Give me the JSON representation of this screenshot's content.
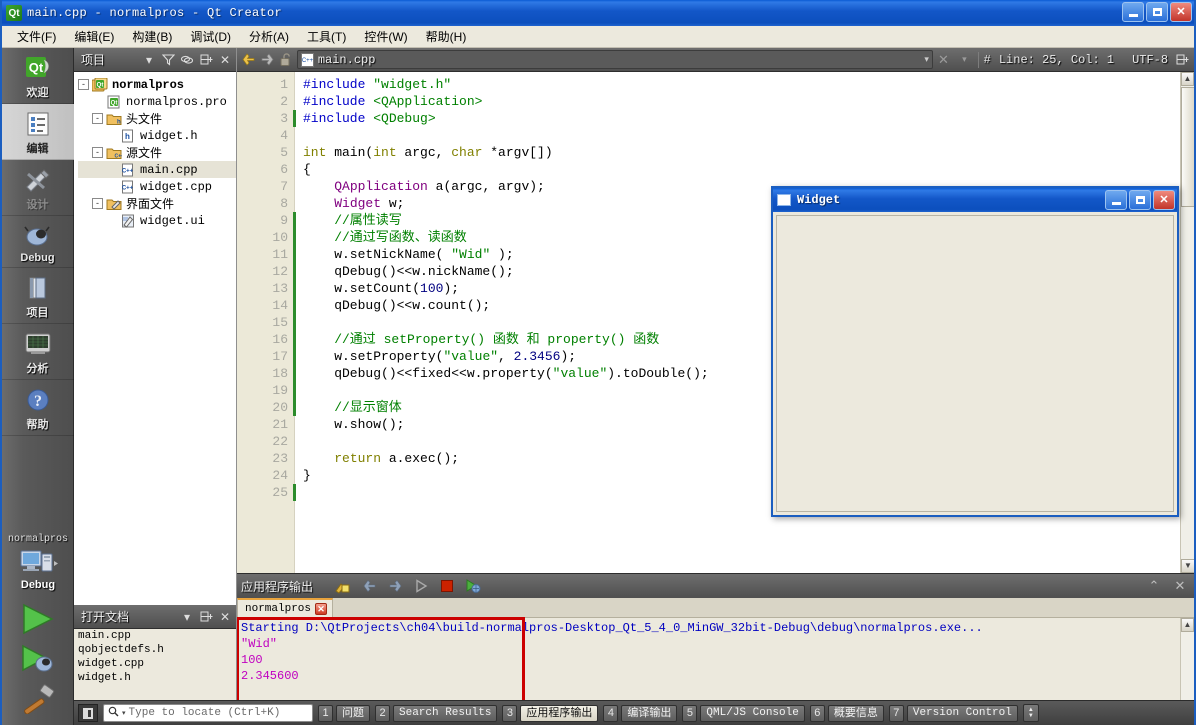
{
  "window": {
    "title": "main.cpp - normalpros - Qt Creator",
    "app_icon": "qt-logo-icon",
    "buttons": {
      "minimize": "minimize-icon",
      "maximize": "maximize-icon",
      "close": "close-icon"
    }
  },
  "menubar": {
    "items": [
      {
        "label": "文件(F)"
      },
      {
        "label": "编辑(E)"
      },
      {
        "label": "构建(B)"
      },
      {
        "label": "调试(D)"
      },
      {
        "label": "分析(A)"
      },
      {
        "label": "工具(T)"
      },
      {
        "label": "控件(W)"
      },
      {
        "label": "帮助(H)"
      }
    ]
  },
  "modebar": {
    "modes": [
      {
        "label": "欢迎",
        "icon": "qt-welcome-icon",
        "glyph": "Qt",
        "state": "normal"
      },
      {
        "label": "编辑",
        "icon": "edit-document-icon",
        "glyph": "▤",
        "state": "active"
      },
      {
        "label": "设计",
        "icon": "design-brush-icon",
        "glyph": "✎",
        "state": "disabled"
      },
      {
        "label": "Debug",
        "icon": "debug-bug-icon",
        "glyph": "🐞",
        "state": "normal"
      },
      {
        "label": "项目",
        "icon": "projects-folder-icon",
        "glyph": "📑",
        "state": "normal"
      },
      {
        "label": "分析",
        "icon": "analyze-monitor-icon",
        "glyph": "▦",
        "state": "normal"
      },
      {
        "label": "帮助",
        "icon": "help-question-icon",
        "glyph": "?",
        "state": "normal"
      }
    ],
    "kit": {
      "project_name": "normalpros",
      "icon": "target-computer-icon",
      "build_config": "Debug",
      "run_button": "run-play-icon",
      "debug_button": "start-debugging-icon",
      "build_button": "build-hammer-icon"
    }
  },
  "project_panel": {
    "title": "项目",
    "toolbar": [
      {
        "name": "filter-icon",
        "glyph": "▽"
      },
      {
        "name": "link-with-editor-icon",
        "glyph": "⛓"
      },
      {
        "name": "split-icon",
        "glyph": "⊟"
      },
      {
        "name": "close-icon",
        "glyph": "✕"
      }
    ],
    "tree": [
      {
        "depth": 0,
        "label": "normalpros",
        "icon": "qt-project-icon",
        "expander": "-",
        "bold": true,
        "selected": false
      },
      {
        "depth": 1,
        "label": "normalpros.pro",
        "icon": "pro-file-icon",
        "expander": "",
        "bold": false,
        "selected": false
      },
      {
        "depth": 1,
        "label": "头文件",
        "icon": "folder-h-icon",
        "expander": "-",
        "bold": false,
        "selected": false
      },
      {
        "depth": 2,
        "label": "widget.h",
        "icon": "header-file-icon",
        "expander": "",
        "bold": false,
        "selected": false
      },
      {
        "depth": 1,
        "label": "源文件",
        "icon": "folder-cpp-icon",
        "expander": "-",
        "bold": false,
        "selected": false
      },
      {
        "depth": 2,
        "label": "main.cpp",
        "icon": "cpp-file-icon",
        "expander": "",
        "bold": false,
        "selected": true
      },
      {
        "depth": 2,
        "label": "widget.cpp",
        "icon": "cpp-file-icon",
        "expander": "",
        "bold": false,
        "selected": false
      },
      {
        "depth": 1,
        "label": "界面文件",
        "icon": "folder-ui-icon",
        "expander": "-",
        "bold": false,
        "selected": false
      },
      {
        "depth": 2,
        "label": "widget.ui",
        "icon": "ui-file-icon",
        "expander": "",
        "bold": false,
        "selected": false
      }
    ]
  },
  "open_documents": {
    "title": "打开文档",
    "toolbar": [
      {
        "name": "chevron-down-icon",
        "glyph": "▾"
      },
      {
        "name": "split-icon",
        "glyph": "⊟"
      },
      {
        "name": "close-icon",
        "glyph": "✕"
      }
    ],
    "items": [
      {
        "label": "main.cpp"
      },
      {
        "label": "qobjectdefs.h"
      },
      {
        "label": "widget.cpp"
      },
      {
        "label": "widget.h"
      }
    ]
  },
  "editor_toolbar": {
    "back_icon": "navigate-back-icon",
    "forward_icon": "navigate-forward-icon",
    "lock_icon": "unlocked-padlock-icon",
    "current_file": "main.cpp",
    "file_icon": "cpp-file-icon",
    "dropdown_icon": "chevron-down-icon",
    "close_icon": "close-icon",
    "symbol_dropdown_icon": "chevron-down-icon",
    "hash_icon": "line-column-icon",
    "line_col": "Line: 25, Col: 1",
    "encoding": "UTF-8",
    "split_icon": "split-editor-icon"
  },
  "editor": {
    "first_line": 1,
    "total_lines": 25,
    "lines": [
      {
        "n": 1,
        "fold": "",
        "changed": false,
        "tokens": [
          {
            "t": "#include ",
            "c": "k-pre"
          },
          {
            "t": "\"widget.h\"",
            "c": "k-str"
          }
        ]
      },
      {
        "n": 2,
        "fold": "",
        "changed": false,
        "tokens": [
          {
            "t": "#include ",
            "c": "k-pre"
          },
          {
            "t": "<QApplication>",
            "c": "k-str"
          }
        ]
      },
      {
        "n": 3,
        "fold": "",
        "changed": true,
        "tokens": [
          {
            "t": "#include ",
            "c": "k-pre"
          },
          {
            "t": "<QDebug>",
            "c": "k-str"
          }
        ]
      },
      {
        "n": 4,
        "fold": "",
        "changed": false,
        "tokens": []
      },
      {
        "n": 5,
        "fold": "-",
        "changed": false,
        "tokens": [
          {
            "t": "int",
            "c": "k-kw"
          },
          {
            "t": " main(",
            "c": "k-op"
          },
          {
            "t": "int",
            "c": "k-kw"
          },
          {
            "t": " argc, ",
            "c": "k-op"
          },
          {
            "t": "char",
            "c": "k-kw"
          },
          {
            "t": " *argv[])",
            "c": "k-op"
          }
        ]
      },
      {
        "n": 6,
        "fold": "",
        "changed": false,
        "tokens": [
          {
            "t": "{",
            "c": "k-op"
          }
        ]
      },
      {
        "n": 7,
        "fold": "",
        "changed": false,
        "tokens": [
          {
            "t": "    ",
            "c": "k-op"
          },
          {
            "t": "QApplication",
            "c": "k-typ"
          },
          {
            "t": " a(argc, argv);",
            "c": "k-op"
          }
        ]
      },
      {
        "n": 8,
        "fold": "",
        "changed": false,
        "tokens": [
          {
            "t": "    ",
            "c": "k-op"
          },
          {
            "t": "Widget",
            "c": "k-typ"
          },
          {
            "t": " w;",
            "c": "k-op"
          }
        ]
      },
      {
        "n": 9,
        "fold": "",
        "changed": true,
        "tokens": [
          {
            "t": "    //属性读写",
            "c": "k-cmt"
          }
        ]
      },
      {
        "n": 10,
        "fold": "",
        "changed": true,
        "tokens": [
          {
            "t": "    //通过写函数、读函数",
            "c": "k-cmt"
          }
        ]
      },
      {
        "n": 11,
        "fold": "",
        "changed": true,
        "tokens": [
          {
            "t": "    w.setNickName( ",
            "c": "k-op"
          },
          {
            "t": "\"Wid\"",
            "c": "k-str"
          },
          {
            "t": " );",
            "c": "k-op"
          }
        ]
      },
      {
        "n": 12,
        "fold": "",
        "changed": true,
        "tokens": [
          {
            "t": "    qDebug()<<w.nickName();",
            "c": "k-op"
          }
        ]
      },
      {
        "n": 13,
        "fold": "",
        "changed": true,
        "tokens": [
          {
            "t": "    w.setCount(",
            "c": "k-op"
          },
          {
            "t": "100",
            "c": "k-num"
          },
          {
            "t": ");",
            "c": "k-op"
          }
        ]
      },
      {
        "n": 14,
        "fold": "",
        "changed": true,
        "tokens": [
          {
            "t": "    qDebug()<<w.count();",
            "c": "k-op"
          }
        ]
      },
      {
        "n": 15,
        "fold": "",
        "changed": true,
        "tokens": []
      },
      {
        "n": 16,
        "fold": "",
        "changed": true,
        "tokens": [
          {
            "t": "    //通过 setProperty() 函数 和 property() 函数",
            "c": "k-cmt"
          }
        ]
      },
      {
        "n": 17,
        "fold": "",
        "changed": true,
        "tokens": [
          {
            "t": "    w.setProperty(",
            "c": "k-op"
          },
          {
            "t": "\"value\"",
            "c": "k-str"
          },
          {
            "t": ", ",
            "c": "k-op"
          },
          {
            "t": "2.3456",
            "c": "k-num"
          },
          {
            "t": ");",
            "c": "k-op"
          }
        ]
      },
      {
        "n": 18,
        "fold": "",
        "changed": true,
        "tokens": [
          {
            "t": "    qDebug()<<fixed<<w.property(",
            "c": "k-op"
          },
          {
            "t": "\"value\"",
            "c": "k-str"
          },
          {
            "t": ").toDouble();",
            "c": "k-op"
          }
        ]
      },
      {
        "n": 19,
        "fold": "",
        "changed": true,
        "tokens": []
      },
      {
        "n": 20,
        "fold": "",
        "changed": true,
        "tokens": [
          {
            "t": "    //显示窗体",
            "c": "k-cmt"
          }
        ]
      },
      {
        "n": 21,
        "fold": "",
        "changed": false,
        "tokens": [
          {
            "t": "    w.show();",
            "c": "k-op"
          }
        ]
      },
      {
        "n": 22,
        "fold": "",
        "changed": false,
        "tokens": []
      },
      {
        "n": 23,
        "fold": "",
        "changed": false,
        "tokens": [
          {
            "t": "    ",
            "c": "k-op"
          },
          {
            "t": "return",
            "c": "k-kw"
          },
          {
            "t": " a.exec();",
            "c": "k-op"
          }
        ]
      },
      {
        "n": 24,
        "fold": "",
        "changed": false,
        "tokens": [
          {
            "t": "}",
            "c": "k-op"
          }
        ]
      },
      {
        "n": 25,
        "fold": "",
        "changed": true,
        "tokens": []
      }
    ]
  },
  "output_pane": {
    "title": "应用程序输出",
    "toolbar": [
      {
        "name": "clear-output-icon",
        "glyph": "🧹",
        "color": "#e2b53a"
      },
      {
        "name": "previous-item-icon",
        "glyph": "◀",
        "color": "#9aa8bb"
      },
      {
        "name": "next-item-icon",
        "glyph": "▶",
        "color": "#9aa8bb"
      },
      {
        "name": "run-icon",
        "glyph": "▶",
        "color": "#9b9b9b"
      },
      {
        "name": "stop-icon",
        "glyph": "■",
        "color": "#cc2200"
      },
      {
        "name": "attach-debugger-icon",
        "glyph": "▶",
        "color": "#3f9b3f"
      }
    ],
    "collapse_icon": "chevron-up-icon",
    "close_icon": "close-icon",
    "tabs": [
      {
        "label": "normalpros",
        "close_icon": "close-tab-icon",
        "active": true
      }
    ],
    "lines": [
      {
        "text": "Starting D:\\QtProjects\\ch04\\build-normalpros-Desktop_Qt_5_4_0_MinGW_32bit-Debug\\debug\\normalpros.exe...",
        "color": "o-blue"
      },
      {
        "text": "\"Wid\"",
        "color": "o-mag"
      },
      {
        "text": "100",
        "color": "o-mag"
      },
      {
        "text": "2.345600",
        "color": "o-mag"
      }
    ]
  },
  "statusbar": {
    "sidebar_toggle_icon": "toggle-sidebar-icon",
    "locator": {
      "icon": "search-icon",
      "placeholder": "Type to locate (Ctrl+K)",
      "value": ""
    },
    "panes": [
      {
        "num": "1",
        "label": "问题",
        "active": false,
        "cn": true
      },
      {
        "num": "2",
        "label": "Search Results",
        "active": false,
        "cn": false
      },
      {
        "num": "3",
        "label": "应用程序输出",
        "active": true,
        "cn": true
      },
      {
        "num": "4",
        "label": "编译输出",
        "active": false,
        "cn": true
      },
      {
        "num": "5",
        "label": "QML/JS Console",
        "active": false,
        "cn": false
      },
      {
        "num": "6",
        "label": "概要信息",
        "active": false,
        "cn": true
      },
      {
        "num": "7",
        "label": "Version Control",
        "active": false,
        "cn": false
      }
    ],
    "spin_icon": "spin-updown-icon"
  },
  "widget_window": {
    "title": "Widget",
    "icon": "window-icon",
    "buttons": {
      "minimize": "minimize-icon",
      "maximize": "maximize-icon",
      "close": "close-icon"
    }
  },
  "colors": {
    "title_blue": "#1357c8",
    "accent_orange": "#e8a33d",
    "highlight_red": "#cc0000",
    "output_blue": "#0000c0",
    "output_magenta": "#c000c0"
  }
}
